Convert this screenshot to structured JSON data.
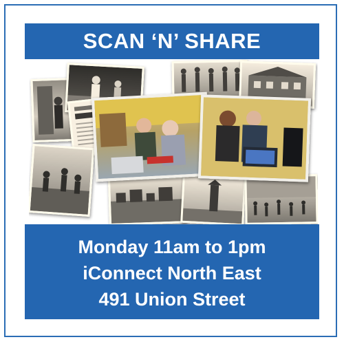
{
  "title": "SCAN ‘N’ SHARE",
  "info": {
    "line1": "Monday 11am to 1pm",
    "line2": "iConnect North East",
    "line3": "491 Union Street"
  },
  "colors": {
    "banner": "#2466b1",
    "border": "#2a6db5",
    "text": "#ffffff"
  }
}
